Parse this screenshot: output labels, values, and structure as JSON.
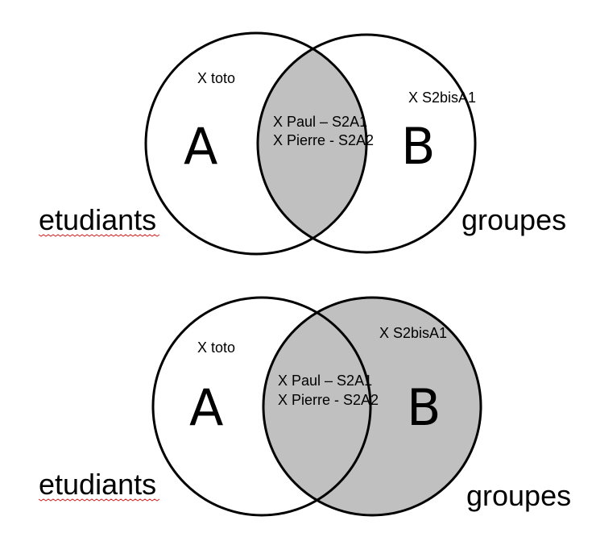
{
  "colors": {
    "shade": "#c0c0c0",
    "outline": "#000000",
    "spellcheck": "#d42020"
  },
  "diagram_top": {
    "set_a_letter": "A",
    "set_b_letter": "B",
    "set_a_item": "X toto",
    "set_b_item": "X S2bisA1",
    "intersection_item_1": "X Paul – S2A1",
    "intersection_item_2": "X Pierre - S2A2",
    "set_a_name": "etudiants",
    "set_b_name": "groupes",
    "shaded_region": "A ∩ B"
  },
  "diagram_bottom": {
    "set_a_letter": "A",
    "set_b_letter": "B",
    "set_a_item": "X toto",
    "set_b_item": "X S2bisA1",
    "intersection_item_1": "X Paul – S2A1",
    "intersection_item_2": "X Pierre - S2A2",
    "set_a_name": "etudiants",
    "set_b_name": "groupes",
    "shaded_region": "B"
  }
}
